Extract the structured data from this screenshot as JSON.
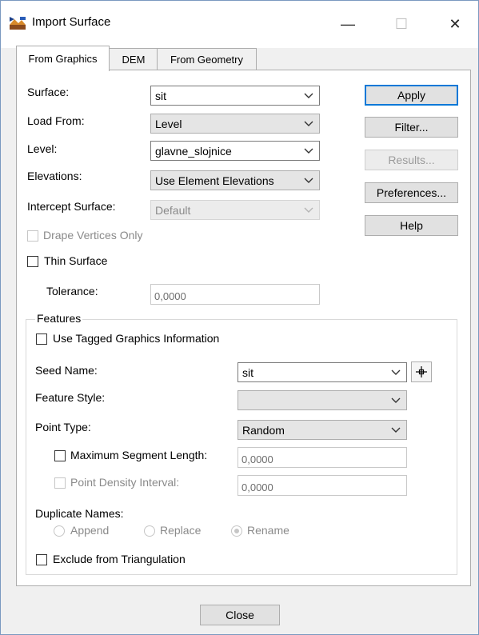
{
  "window": {
    "title": "Import Surface",
    "minimize_glyph": "—",
    "maximize_glyph": "☐",
    "close_glyph": "✕"
  },
  "tabs": [
    {
      "label": "From Graphics",
      "active": true
    },
    {
      "label": "DEM",
      "active": false
    },
    {
      "label": "From Geometry",
      "active": false
    }
  ],
  "form": {
    "surface": {
      "label": "Surface:",
      "value": "sit"
    },
    "load_from": {
      "label": "Load From:",
      "value": "Level"
    },
    "level": {
      "label": "Level:",
      "value": "glavne_slojnice"
    },
    "elevations": {
      "label": "Elevations:",
      "value": "Use Element Elevations"
    },
    "intercept_surface": {
      "label": "Intercept Surface:",
      "value": "Default",
      "disabled": true
    },
    "drape_vertices_only": {
      "label": "Drape Vertices Only",
      "checked": false,
      "disabled": true
    },
    "thin_surface": {
      "label": "Thin Surface",
      "checked": false
    },
    "tolerance": {
      "label": "Tolerance:",
      "value": "0,0000",
      "disabled": true
    }
  },
  "buttons": {
    "apply": "Apply",
    "filter": "Filter...",
    "results": "Results...",
    "preferences": "Preferences...",
    "help": "Help",
    "close": "Close"
  },
  "features": {
    "title": "Features",
    "use_tagged": {
      "label": "Use Tagged Graphics Information",
      "checked": false
    },
    "seed_name": {
      "label": "Seed Name:",
      "value": "sit"
    },
    "feature_style": {
      "label": "Feature Style:",
      "value": ""
    },
    "point_type": {
      "label": "Point Type:",
      "value": "Random"
    },
    "max_segment_length": {
      "label": "Maximum Segment Length:",
      "value": "0,0000",
      "checked": false
    },
    "point_density_interval": {
      "label": "Point Density Interval:",
      "value": "0,0000",
      "checked": false,
      "disabled": true
    },
    "duplicate_names": {
      "label": "Duplicate Names:",
      "options": [
        "Append",
        "Replace",
        "Rename"
      ],
      "selected": "Rename",
      "disabled": true
    },
    "exclude_triangulation": {
      "label": "Exclude from Triangulation",
      "checked": false
    }
  },
  "colors": {
    "accent": "#0078d7",
    "dialog_bg": "#f0f0f0",
    "panel_bg": "#ffffff"
  },
  "icons": {
    "app": "surface-app-icon",
    "pick": "crosshair-pick-icon",
    "dropdown": "chevron-down-icon"
  }
}
